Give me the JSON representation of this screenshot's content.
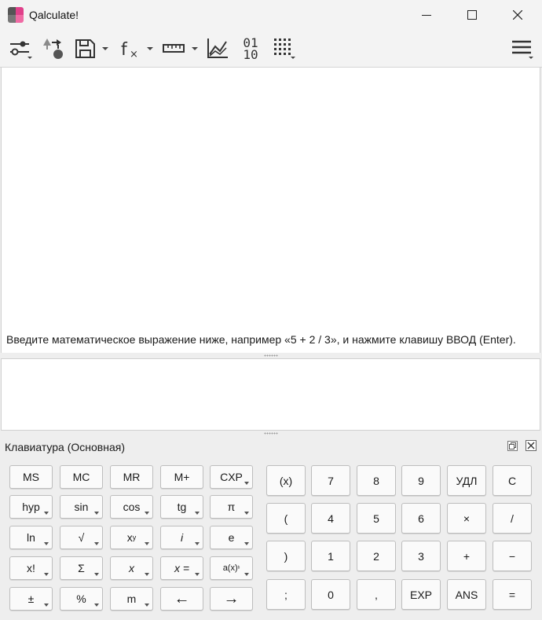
{
  "window": {
    "title": "Qalculate!"
  },
  "toolbar": {
    "items": [
      "mode-settings",
      "convert-to-unit",
      "save",
      "functions",
      "units",
      "plot",
      "number-bases",
      "keypad-modes",
      "main-menu"
    ],
    "number_bases_top": "01",
    "number_bases_bottom": "10"
  },
  "history": {
    "hint": "Введите математическое выражение ниже, например «5 + 2 / 3», и нажмите клавишу ВВОД (Enter)."
  },
  "expression": {
    "value": ""
  },
  "keypad": {
    "title": "Клавиатура (Основная)",
    "left": [
      [
        "MS",
        "MC",
        "MR",
        "M+",
        "CXP"
      ],
      [
        "hyp",
        "sin",
        "cos",
        "tg",
        "π"
      ],
      [
        "ln",
        "√",
        "x",
        "i",
        "e"
      ],
      [
        "x!",
        "Σ",
        "x",
        "x =",
        "a(x)"
      ],
      [
        "±",
        "%",
        "m",
        "←",
        "→"
      ]
    ],
    "left_superscripts": {
      "xy": "y",
      "ax": "ᵇ"
    },
    "right": [
      [
        "(x)",
        "7",
        "8",
        "9",
        "УДЛ",
        "C"
      ],
      [
        "(",
        "4",
        "5",
        "6",
        "×",
        "/"
      ],
      [
        ")",
        "1",
        "2",
        "3",
        "+",
        "−"
      ],
      [
        ";",
        "0",
        ",",
        "EXP",
        "ANS",
        "="
      ]
    ]
  },
  "colors": {
    "accent": "#e0408a",
    "window_bg": "#eeeeee",
    "panel_bg": "#ffffff"
  }
}
